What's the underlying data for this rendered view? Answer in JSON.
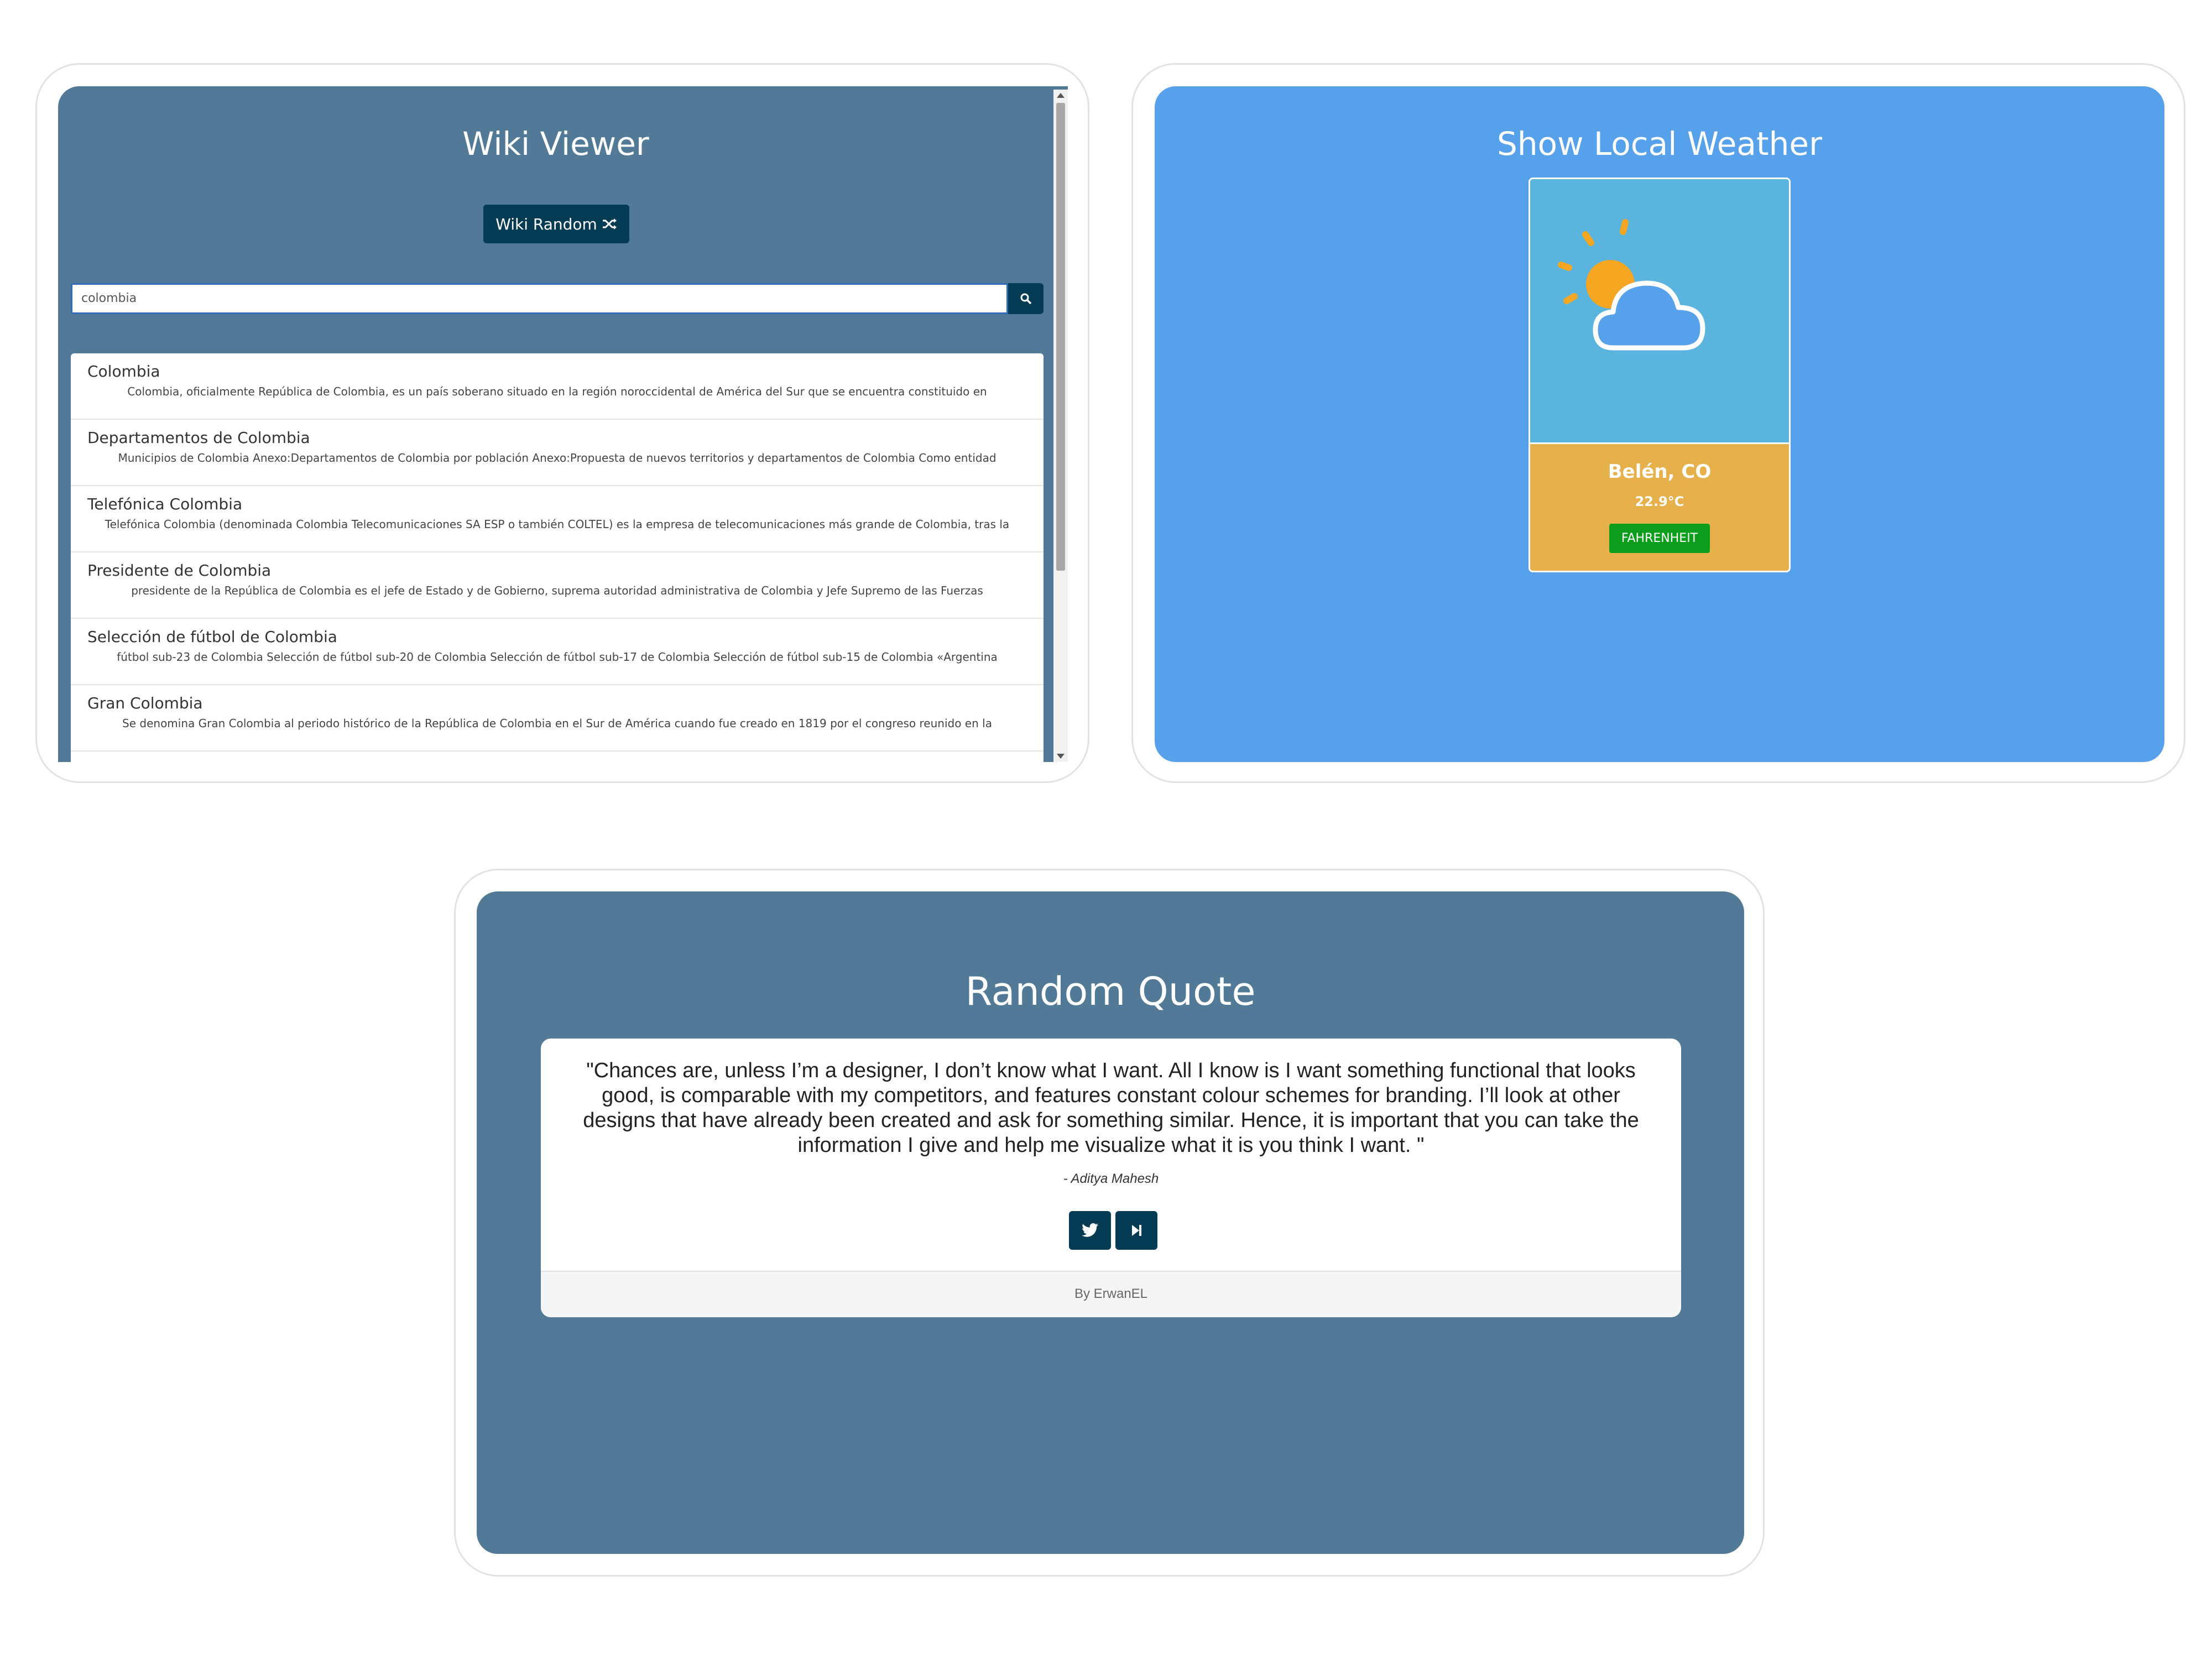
{
  "wiki": {
    "title": "Wiki Viewer",
    "random_label": "Wiki Random",
    "search_value": "colombia",
    "results": [
      {
        "title": "Colombia",
        "snippet": "Colombia, oficialmente República de Colombia, es un país soberano situado en la región noroccidental de América del Sur que se encuentra constituido en"
      },
      {
        "title": "Departamentos de Colombia",
        "snippet": "Municipios de Colombia Anexo:Departamentos de Colombia por población Anexo:Propuesta de nuevos territorios y departamentos de Colombia Como entidad"
      },
      {
        "title": "Telefónica Colombia",
        "snippet": "Telefónica Colombia (denominada Colombia Telecomunicaciones SA ESP o también COLTEL) es la empresa de telecomunicaciones más grande de Colombia, tras la"
      },
      {
        "title": "Presidente de Colombia",
        "snippet": "presidente de la República de Colombia es el jefe de Estado y de Gobierno, suprema autoridad administrativa de Colombia y Jefe Supremo de las Fuerzas"
      },
      {
        "title": "Selección de fútbol de Colombia",
        "snippet": "fútbol sub-23 de Colombia Selección de fútbol sub-20 de Colombia Selección de fútbol sub-17 de Colombia Selección de fútbol sub-15 de Colombia «Argentina"
      },
      {
        "title": "Gran Colombia",
        "snippet": "Se denomina Gran Colombia al periodo histórico de la República de Colombia en el Sur de América cuando fue creado en 1819 por el congreso reunido en la"
      }
    ]
  },
  "weather": {
    "title": "Show Local Weather",
    "city": "Belén, CO",
    "temperature": "22.9°C",
    "unit_button": "FAHRENHEIT",
    "icon": "partly-cloudy-icon"
  },
  "quote": {
    "title": "Random Quote",
    "text": "\"Chances are, unless I’m a designer, I don’t know what I want. All I know is I want something functional that looks good, is comparable with my competitors, and features constant colour schemes for branding. I’ll look at other designs that have already been created and ask for something similar. Hence, it is important that you can take the information I give and help me visualize what it is you think I want. \"",
    "author": "- Aditya Mahesh",
    "footer": "By ErwanEL"
  },
  "colors": {
    "wiki_bg": "#527a96",
    "weather_bg": "#57a0ea",
    "button_dark": "#053c54",
    "weather_card_top": "#5ab4dd",
    "weather_card_bottom": "#e6b04a",
    "fahrenheit_button": "#0c9d1c"
  }
}
